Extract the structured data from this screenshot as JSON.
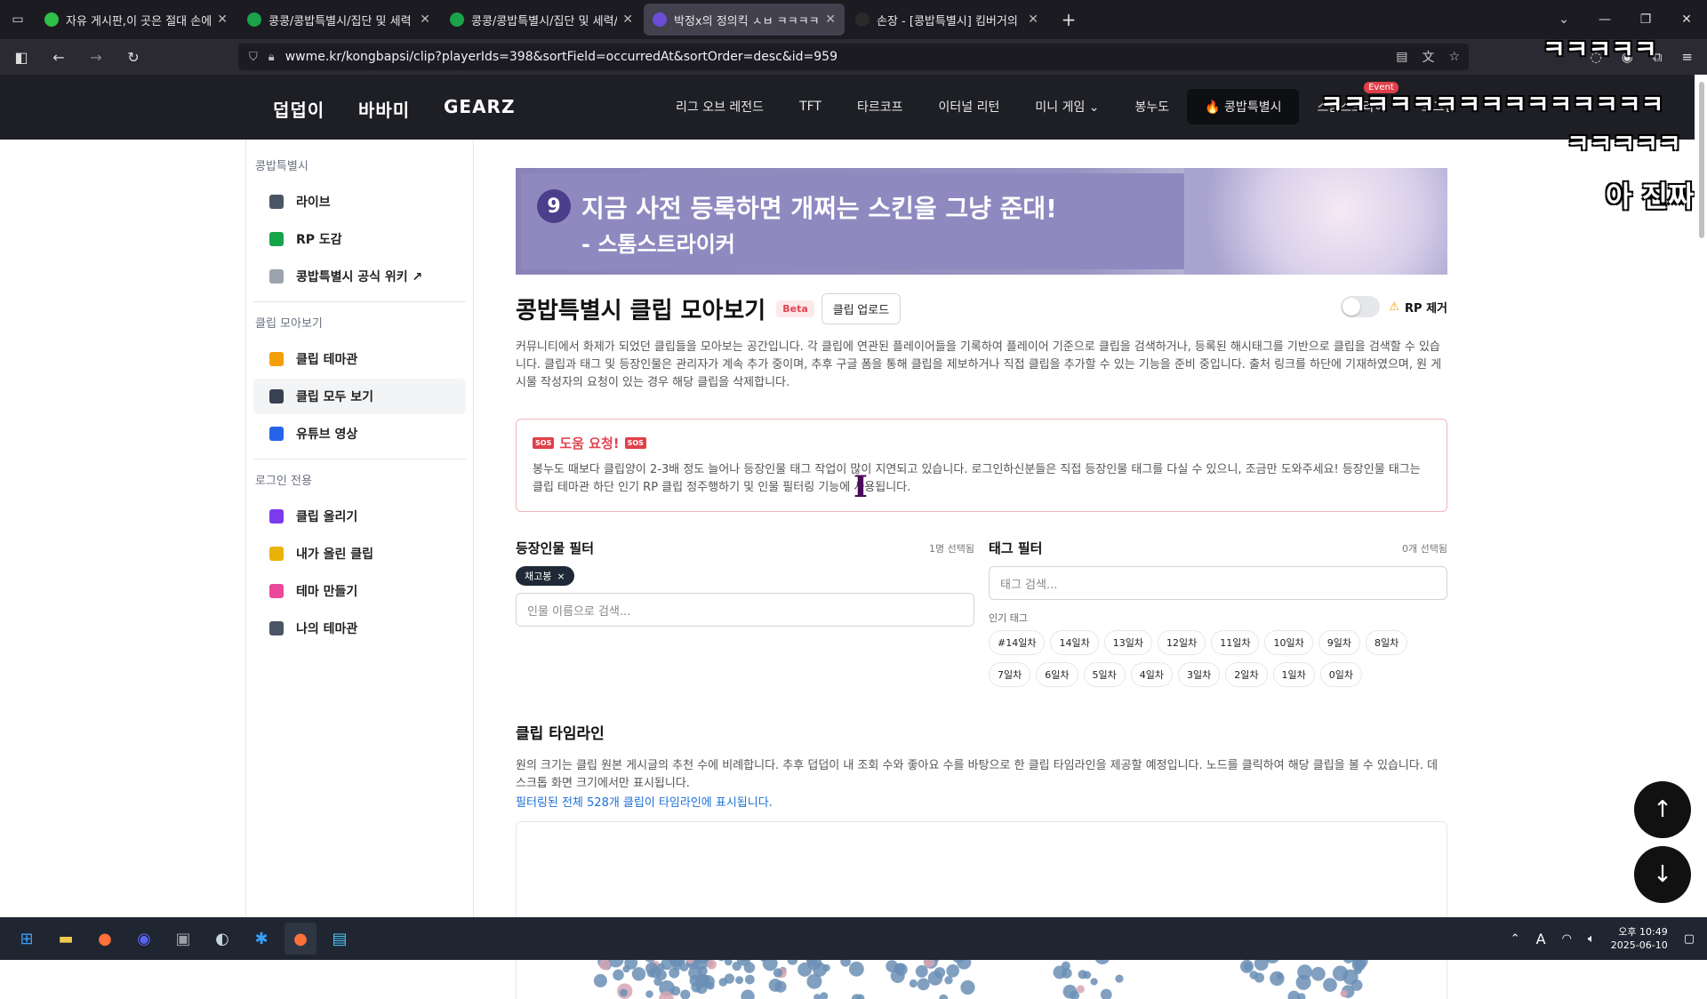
{
  "browser": {
    "tabs": [
      {
        "title": "자유 게시판,이 곳은 절대 손에",
        "color": "#2fbf4a",
        "active": false
      },
      {
        "title": "콩콩/콩밥특별시/집단 및 세력",
        "color": "#1aa34a",
        "active": false
      },
      {
        "title": "콩콩/콩밥특별시/집단 및 세력/",
        "color": "#1aa34a",
        "active": false
      },
      {
        "title": "박정x의 정의킥 ㅅㅂ ㅋㅋㅋㅋ",
        "color": "#6b4dd6",
        "active": true
      },
      {
        "title": "손장 - [콩밥특별시] 킴버거의 (",
        "color": "#2a2a2a",
        "active": false
      }
    ],
    "new_tab": "+",
    "url": "wwme.kr/kongbapsi/clip?playerIds=398&sortField=occurredAt&sortOrder=desc&id=959"
  },
  "site": {
    "brands": [
      "덥덥이",
      "바바미",
      "GEARZ"
    ],
    "nav": [
      {
        "label": "리그 오브 레전드",
        "active": false
      },
      {
        "label": "TFT",
        "active": false
      },
      {
        "label": "타르코프",
        "active": false
      },
      {
        "label": "이터널 리턴",
        "active": false
      },
      {
        "label": "미니 게임 ⌄",
        "active": false
      },
      {
        "label": "봉누도",
        "active": false
      },
      {
        "label": "🔥 콩밥특별시",
        "active": true
      },
      {
        "label": "스톰스트라이",
        "active": false,
        "badge": "Event"
      },
      {
        "label": "로그인",
        "active": false
      }
    ]
  },
  "overlay": {
    "line1": "ㅋㅋㅋㅋㅋ",
    "line2": "ㅋㅋㅋㅋㅋㅋㅋㅋㅋㅋㅋㅋㅋㅋㅋ",
    "line3": "ㅋㅋㅋㅋㅋ",
    "line4": "아 진짜"
  },
  "sidebar": {
    "groups": [
      {
        "label": "콩밥특별시",
        "items": [
          {
            "label": "라이브",
            "icon": "live-icon",
            "color": "#4b5563",
            "active": false
          },
          {
            "label": "RP 도감",
            "icon": "book-icon",
            "color": "#16a34a",
            "active": false
          },
          {
            "label": "콩밥특별시 공식 위키 ↗",
            "icon": "link-icon",
            "color": "#9ca3af",
            "active": false
          }
        ]
      },
      {
        "label": "클립 모아보기",
        "items": [
          {
            "label": "클립 테마관",
            "icon": "theme-icon",
            "color": "#f59e0b",
            "active": false
          },
          {
            "label": "클립 모두 보기",
            "icon": "clips-icon",
            "color": "#374151",
            "active": true
          },
          {
            "label": "유튜브 영상",
            "icon": "youtube-icon",
            "color": "#2563eb",
            "active": false
          }
        ]
      },
      {
        "label": "로그인 전용",
        "items": [
          {
            "label": "클립 올리기",
            "icon": "upload-icon",
            "color": "#7c3aed",
            "active": false
          },
          {
            "label": "내가 올린 클립",
            "icon": "folder-icon",
            "color": "#eab308",
            "active": false
          },
          {
            "label": "테마 만들기",
            "icon": "palette-icon",
            "color": "#ec4899",
            "active": false
          },
          {
            "label": "나의 테마관",
            "icon": "film-icon",
            "color": "#4b5563",
            "active": false
          }
        ]
      }
    ]
  },
  "banner": {
    "number": "9",
    "line1": "지금 사전 등록하면 개쩌는 스킨을 그냥 준대!",
    "line2": "- 스톰스트라이커"
  },
  "page": {
    "title": "콩밥특별시 클립 모아보기",
    "beta": "Beta",
    "upload_button": "클립 업로드",
    "rp_toggle_label": "RP 제거",
    "description": "커뮤니티에서 화제가 되었던 클립들을 모아보는 공간입니다. 각 클립에 연관된 플레이어들을 기록하여 플레이어 기준으로 클립을 검색하거나, 등록된 해시태그를 기반으로 클립을 검색할 수 있습니다. 클립과 태그 및 등장인물은 관리자가 계속 추가 중이며, 추후 구글 폼을 통해 클립을 제보하거나 직접 클립을 추가할 수 있는 기능을 준비 중입니다. 출처 링크를 하단에 기재하였으며, 원 게시물 작성자의 요청이 있는 경우 해당 클립을 삭제합니다."
  },
  "help": {
    "sos": "SOS",
    "title": "도움 요청!",
    "text": "봉누도 때보다 클립양이 2-3배 정도 늘어나 등장인물 태그 작업이 많이 지연되고 있습니다. 로그인하신분들은 직접 등장인물 태그를 다실 수 있으니, 조금만 도와주세요! 등장인물 태그는 클립 테마관 하단 인기 RP 클립 정주행하기 및 인물 필터링 기능에 사용됩니다."
  },
  "filters": {
    "person": {
      "title": "등장인물 필터",
      "count": "1명 선택됨",
      "selected": "채고봉",
      "remove": "×",
      "placeholder": "인물 이름으로 검색..."
    },
    "tag": {
      "title": "태그 필터",
      "count": "0개 선택됨",
      "placeholder": "태그 검색...",
      "popular_label": "인기 태그",
      "tags": [
        "#14일차",
        "14일차",
        "13일차",
        "12일차",
        "11일차",
        "10일차",
        "9일차",
        "8일차",
        "7일차",
        "6일차",
        "5일차",
        "4일차",
        "3일차",
        "2일차",
        "1일차",
        "0일차"
      ]
    }
  },
  "timeline": {
    "title": "클립 타임라인",
    "description": "원의 크기는 클립 원본 게시글의 추천 수에 비례합니다. 추후 덥덥이 내 조회 수와 좋아요 수를 바탕으로 한 클립 타임라인을 제공할 예정입니다. 노드를 클릭하여 해당 클립을 볼 수 있습니다. 데스크톱 화면 크기에서만 표시됩니다.",
    "link": "필터링된 전체 528개 클립이 타임라인에 표시됩니다.",
    "bubble_color": "#6b8fb5"
  },
  "fab": {
    "up": "↑",
    "down": "↓"
  },
  "taskbar": {
    "apps": [
      {
        "name": "windows-start-icon",
        "glyph": "⊞",
        "color": "#3aa0ff",
        "active": false
      },
      {
        "name": "file-explorer-icon",
        "glyph": "▬",
        "color": "#f2c94c",
        "active": false
      },
      {
        "name": "firefox-icon",
        "glyph": "●",
        "color": "#ff7139",
        "active": false
      },
      {
        "name": "discord-icon",
        "glyph": "◉",
        "color": "#5865f2",
        "active": false
      },
      {
        "name": "app-icon",
        "glyph": "▣",
        "color": "#9aa0a6",
        "active": false
      },
      {
        "name": "steam-icon",
        "glyph": "◐",
        "color": "#c7d5e0",
        "active": false
      },
      {
        "name": "bluetooth-app-icon",
        "glyph": "✱",
        "color": "#3aa0ff",
        "active": false
      },
      {
        "name": "firefox-active-icon",
        "glyph": "●",
        "color": "#ff7139",
        "active": true
      },
      {
        "name": "notepad-icon",
        "glyph": "▤",
        "color": "#4fc3f7",
        "active": false
      }
    ],
    "time": "오후 10:49",
    "date": "2025-06-10"
  }
}
